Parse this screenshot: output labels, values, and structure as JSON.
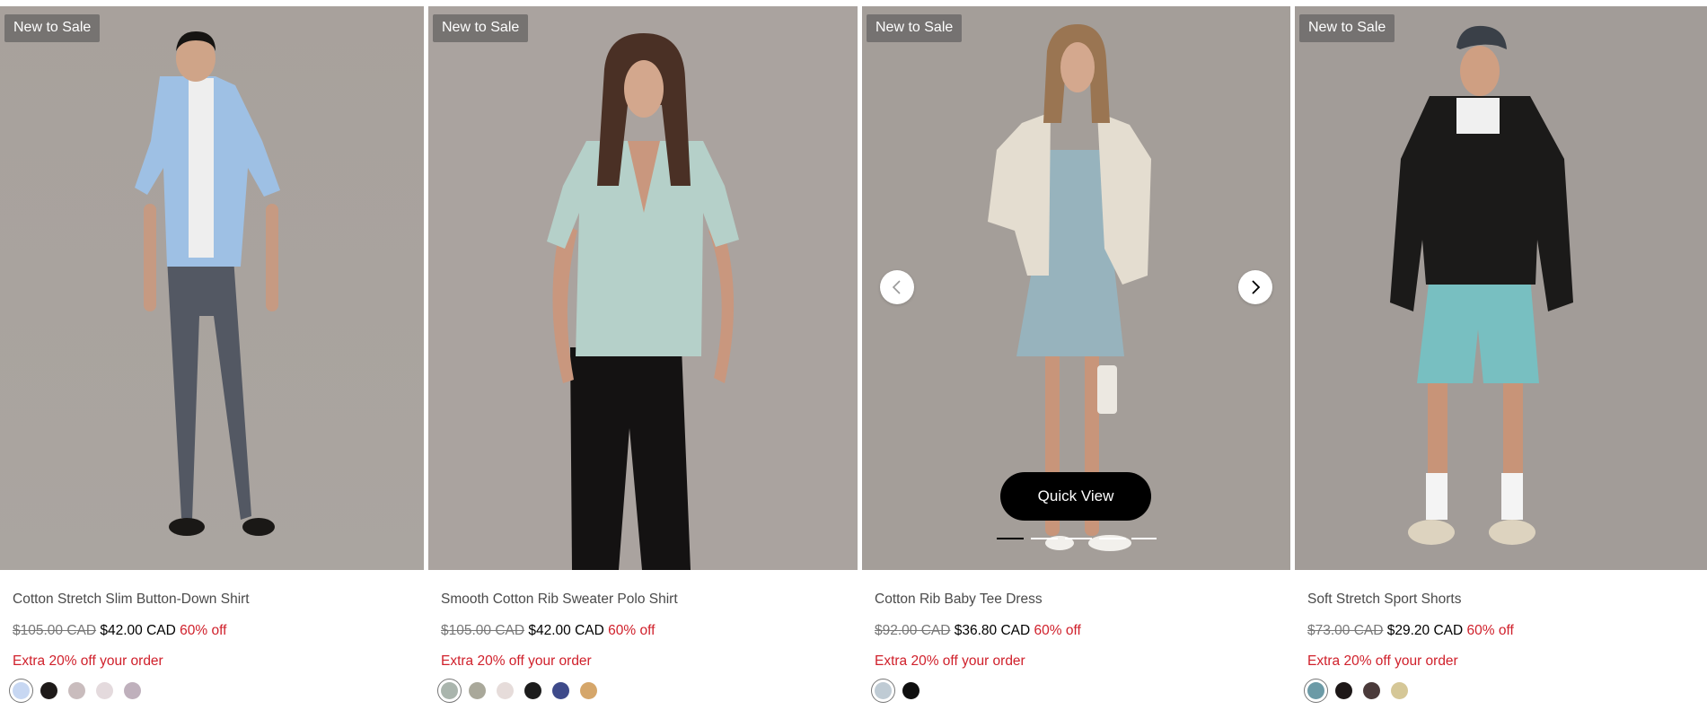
{
  "products": [
    {
      "badge": "New to Sale",
      "name": "Cotton Stretch Slim Button-Down Shirt",
      "old_price": "$105.00 CAD",
      "new_price": "$42.00 CAD",
      "discount": "60% off",
      "promo": "Extra 20% off your order",
      "swatches": [
        "#c7d7f2",
        "#1e1a19",
        "#c9bcbd",
        "#e4dadd",
        "#bfb0bc"
      ]
    },
    {
      "badge": "New to Sale",
      "name": "Smooth Cotton Rib Sweater Polo Shirt",
      "old_price": "$105.00 CAD",
      "new_price": "$42.00 CAD",
      "discount": "60% off",
      "promo": "Extra 20% off your order",
      "swatches": [
        "#aab5ad",
        "#a9a89a",
        "#e6dcda",
        "#1c1c1c",
        "#3e4a8a",
        "#d5a66a"
      ]
    },
    {
      "badge": "New to Sale",
      "name": "Cotton Rib Baby Tee Dress",
      "old_price": "$92.00 CAD",
      "new_price": "$36.80 CAD",
      "discount": "60% off",
      "promo": "Extra 20% off your order",
      "quick_view": "Quick View",
      "swatches": [
        "#bfcbd4",
        "#0f0f0f"
      ]
    },
    {
      "badge": "New to Sale",
      "name": "Soft Stretch Sport Shorts",
      "old_price": "$73.00 CAD",
      "new_price": "$29.20 CAD",
      "discount": "60% off",
      "promo": "Extra 20% off your order",
      "swatches": [
        "#6b9aa6",
        "#1d1717",
        "#4a3a3a",
        "#d5c797"
      ]
    }
  ]
}
